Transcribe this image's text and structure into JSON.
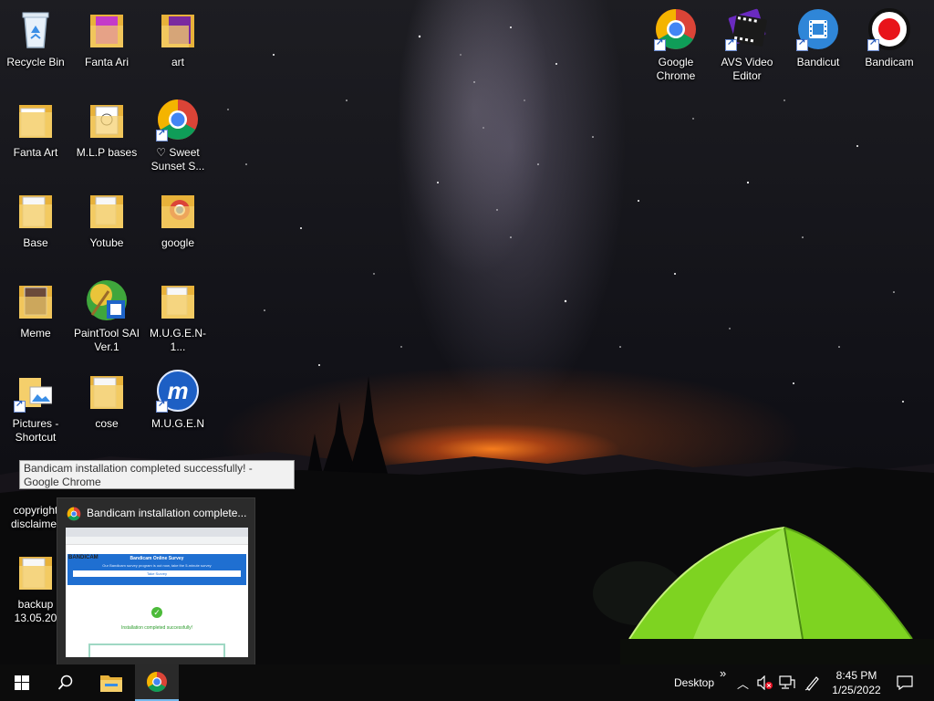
{
  "desktop": {
    "icons": [
      {
        "label": "Recycle Bin",
        "icon": "recycle-bin-icon"
      },
      {
        "label": "Fanta Ari",
        "icon": "folder-icon"
      },
      {
        "label": "art",
        "icon": "folder-icon"
      },
      {
        "label": "Fanta Art",
        "icon": "folder-icon"
      },
      {
        "label": "M.L.P bases",
        "icon": "folder-icon"
      },
      {
        "label": "♡ Sweet\nSunset S...",
        "icon": "chrome-icon"
      },
      {
        "label": "Base",
        "icon": "folder-icon"
      },
      {
        "label": "Yotube",
        "icon": "folder-icon"
      },
      {
        "label": "google",
        "icon": "folder-icon"
      },
      {
        "label": "Meme",
        "icon": "folder-icon"
      },
      {
        "label": "PaintTool SAI\nVer.1",
        "icon": "painttool-sai-icon"
      },
      {
        "label": "M.U.G.E.N-1...",
        "icon": "folder-icon"
      },
      {
        "label": "Pictures -\nShortcut",
        "icon": "folder-icon"
      },
      {
        "label": "cose",
        "icon": "folder-icon"
      },
      {
        "label": "M.U.G.E.N",
        "icon": "mugen-icon"
      },
      {
        "label": "copyright\ndisclaimer",
        "icon": "folder-icon"
      },
      {
        "label": "backup\n13.05.20",
        "icon": "folder-icon"
      },
      {
        "label": "Google\nChrome",
        "icon": "chrome-icon"
      },
      {
        "label": "AVS Video\nEditor",
        "icon": "avs-video-editor-icon"
      },
      {
        "label": "Bandicut",
        "icon": "bandicut-icon"
      },
      {
        "label": "Bandicam",
        "icon": "bandicam-icon"
      }
    ]
  },
  "tooltip": {
    "text": "Bandicam installation completed successfully! - Google Chrome"
  },
  "preview": {
    "title": "Bandicam installation complete...",
    "page": {
      "brand": "BANDICAM",
      "survey_title": "Bandicam Online Survey",
      "survey_text": "Our Bandicam survey program is out now, take the 5-minute survey",
      "survey_button": "Take Survey",
      "success_text": "Installation completed successfully!"
    }
  },
  "taskbar": {
    "desktop_label": "Desktop",
    "overflow": "»",
    "time": "8:45 PM",
    "date": "1/25/2022"
  },
  "colors": {
    "taskbar": "#0c0c0c",
    "active_indicator": "#76b9ed",
    "tent": "#7ed321",
    "chrome_red": "#db4437",
    "chrome_yellow": "#f4b400",
    "chrome_green": "#0f9d58",
    "chrome_blue": "#4285f4"
  }
}
